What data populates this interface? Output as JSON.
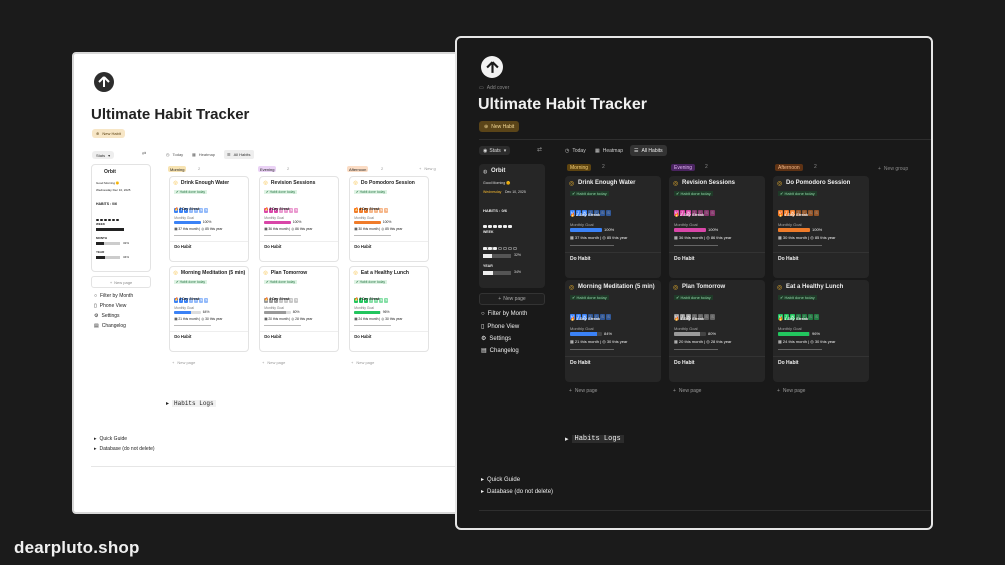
{
  "brand": "dearpluto.shop",
  "light": {
    "title": "Ultimate Habit Tracker",
    "new_habit": "New Habit",
    "stats_label": "Stats",
    "tabs": [
      "Today",
      "Heatmap",
      "All Habits"
    ],
    "groups": [
      {
        "name": "Morning",
        "count": "2"
      },
      {
        "name": "Evening",
        "count": "2"
      },
      {
        "name": "Afternoon",
        "count": "2"
      }
    ],
    "new_group": "New g",
    "orbit": {
      "name": "Orbit",
      "greeting": "Good Morning 🌞",
      "date": "Wednesday Dec 10, 2025",
      "habits": "HABITS : 0/6",
      "week": "WEEK",
      "month": "MONTH",
      "month_pct": "32%",
      "year": "YEAR",
      "year_pct": "34%"
    },
    "new_page": "New page",
    "side_links": [
      "Filter by Month",
      "Phone View",
      "Settings",
      "Changelog"
    ],
    "cards": [
      {
        "title": "Drink Enough Water",
        "done": "Habit done today",
        "streak": "2 Day Streak",
        "goal": "Monthly Goal",
        "pct": "100%",
        "month": "37 this month",
        "year": "85 this year",
        "btn": "Do Habit"
      },
      {
        "title": "Revision Sessions",
        "done": "Habit done today",
        "streak": "3 Day Streak",
        "goal": "Monthly Goal",
        "pct": "100%",
        "month": "36 this month",
        "year": "86 this year",
        "btn": "Do Habit"
      },
      {
        "title": "Do Pomodoro Session",
        "done": "Habit done today",
        "streak": "4 Day Streak",
        "goal": "Monthly Goal",
        "pct": "100%",
        "month": "30 this month",
        "year": "85 this year",
        "btn": "Do Habit"
      },
      {
        "title": "Morning Meditation (5 min)",
        "done": "Habit done today",
        "streak": "3 Day Streak",
        "goal": "Monthly Goal",
        "pct": "64%",
        "month": "21 this month",
        "year": "30 this year",
        "btn": "Do Habit"
      },
      {
        "title": "Plan Tomorrow",
        "done": "Habit done today",
        "streak": "1 Day Streak",
        "goal": "Monthly Goal",
        "pct": "80%",
        "month": "20 this month",
        "year": "28 this year",
        "btn": "Do Habit"
      },
      {
        "title": "Eat a Healthy Lunch",
        "done": "Habit done today",
        "streak": "5 Day Streak",
        "goal": "Monthly Goal",
        "pct": "96%",
        "month": "24 this month",
        "year": "30 this year",
        "btn": "Do Habit"
      }
    ],
    "habits_logs": "Habits Logs",
    "footer_links": [
      "Quick Guide",
      "Database (do not delete)"
    ]
  },
  "dark": {
    "add_cover": "Add cover",
    "title": "Ultimate Habit Tracker",
    "new_habit": "New Habit",
    "stats_label": "Stats",
    "tabs": [
      "Today",
      "Heatmap",
      "All Habits"
    ],
    "groups": [
      {
        "name": "Morning",
        "count": "2"
      },
      {
        "name": "Evening",
        "count": "2"
      },
      {
        "name": "Afternoon",
        "count": "2"
      }
    ],
    "new_group": "New group",
    "orbit": {
      "name": "Orbit",
      "greeting": "Good Morning 🌞",
      "date_day": "Wednesday",
      "date": "Dec 10, 2025",
      "habits": "HABITS : 0/6",
      "week": "WEEK",
      "month": "MONTH",
      "month_pct": "32%",
      "year": "YEAR",
      "year_pct": "34%"
    },
    "new_page": "New page",
    "side_links": [
      "Filter by Month",
      "Phone View",
      "Settings",
      "Changelog"
    ],
    "cards": [
      {
        "title": "Drink Enough Water",
        "done": "Habit done today",
        "streak": "2 Day Streak",
        "goal": "Monthly Goal",
        "pct": "100%",
        "month": "37 this month",
        "year": "85 this year",
        "btn": "Do Habit",
        "color": "#3b82f6",
        "fill": 1.0
      },
      {
        "title": "Revision Sessions",
        "done": "Habit done today",
        "streak": "2 Day Streak",
        "goal": "Monthly Goal",
        "pct": "100%",
        "month": "36 this month",
        "year": "86 this year",
        "btn": "Do Habit",
        "color": "#d946a8",
        "fill": 1.0
      },
      {
        "title": "Do Pomodoro Session",
        "done": "Habit done today",
        "streak": "4 Day Streak",
        "goal": "Monthly Goal",
        "pct": "100%",
        "month": "30 this month",
        "year": "85 this year",
        "btn": "Do Habit",
        "color": "#f07c2a",
        "fill": 1.0
      },
      {
        "title": "Morning Meditation (5 min)",
        "done": "Habit done today",
        "streak": "3 Day Streak",
        "goal": "Monthly Goal",
        "pct": "84%",
        "month": "21 this month",
        "year": "30 this year",
        "btn": "Do Habit",
        "color": "#3b82f6",
        "fill": 0.84
      },
      {
        "title": "Plan Tomorrow",
        "done": "Habit done today",
        "streak": "1 Day Streak",
        "goal": "Monthly Goal",
        "pct": "80%",
        "month": "20 this month",
        "year": "28 this year",
        "btn": "Do Habit",
        "color": "#9a9a9a",
        "fill": 0.8
      },
      {
        "title": "Eat a Healthy Lunch",
        "done": "Habit done today",
        "streak": "1 Day Streak",
        "goal": "Monthly Goal",
        "pct": "96%",
        "month": "24 this month",
        "year": "30 this year",
        "btn": "Do Habit",
        "color": "#22c55e",
        "fill": 0.96
      }
    ],
    "habits_logs": "Habits Logs",
    "footer_links": [
      "Quick Guide",
      "Database (do not delete)"
    ]
  },
  "days": [
    "M",
    "T",
    "W",
    "T",
    "F",
    "S",
    "S"
  ],
  "colors": {
    "morning": "#f5b82e",
    "evening": "#b455e0",
    "afternoon": "#f07c2a",
    "done_green": "#2eaa5b"
  }
}
